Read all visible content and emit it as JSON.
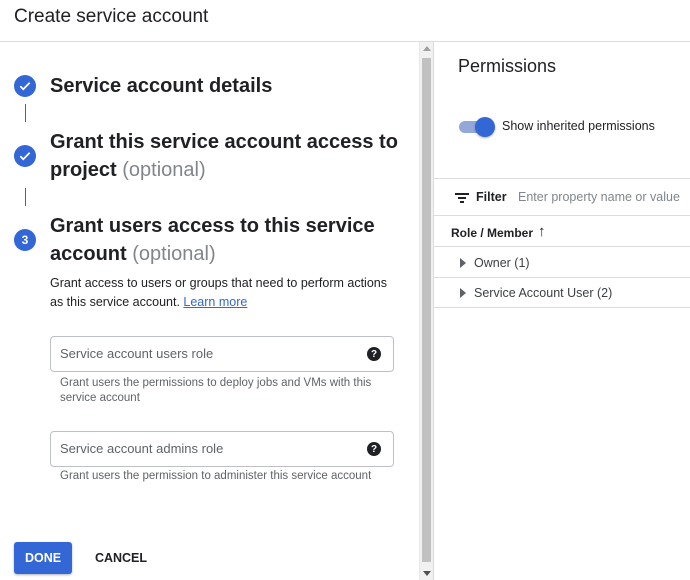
{
  "header": {
    "title": "Create service account"
  },
  "steps": [
    {
      "title": "Service account details",
      "optional": "",
      "done": true
    },
    {
      "title_line1": "Grant this service account access to",
      "title_line2": "project",
      "optional": "(optional)",
      "done": true
    },
    {
      "number": "3",
      "title_line1": "Grant users access to this service",
      "title_line2": "account",
      "optional": "(optional)",
      "done": false
    }
  ],
  "step3": {
    "description": "Grant access to users or groups that need to perform actions as this service account.",
    "learn_more": "Learn more",
    "fields": [
      {
        "placeholder": "Service account users role",
        "hint": "Grant users the permissions to deploy jobs and VMs with this service account"
      },
      {
        "placeholder": "Service account admins role",
        "hint": "Grant users the permission to administer this service account"
      }
    ]
  },
  "actions": {
    "done": "DONE",
    "cancel": "CANCEL"
  },
  "permissions": {
    "title": "Permissions",
    "toggle_label": "Show inherited permissions",
    "toggle_on": true,
    "filter_label": "Filter",
    "filter_placeholder": "Enter property name or value",
    "column_header": "Role / Member",
    "rows": [
      {
        "label": "Owner (1)"
      },
      {
        "label": "Service Account User (2)"
      }
    ]
  },
  "colors": {
    "accent": "#3367d6",
    "text": "#202124",
    "muted": "#80868b"
  }
}
